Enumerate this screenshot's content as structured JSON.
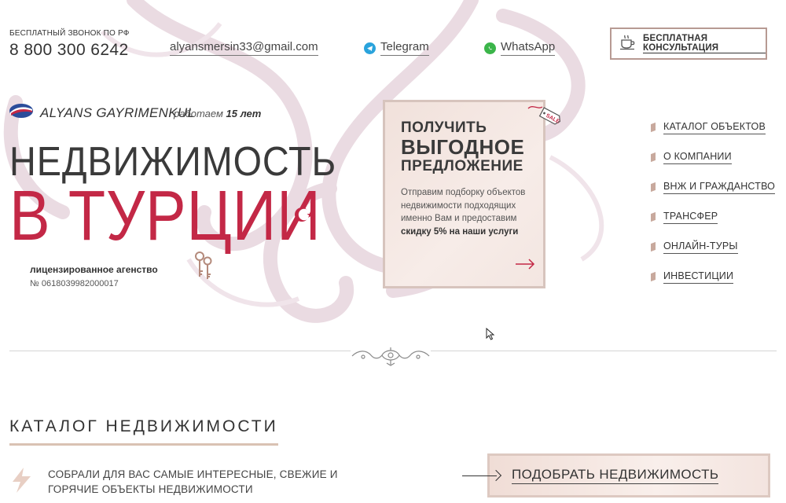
{
  "header": {
    "free_call_label": "БЕСПЛАТНЫЙ ЗВОНОК ПО РФ",
    "phone": "8 800 300 6242",
    "email": "alyansmersin33@gmail.com",
    "telegram_label": "Telegram",
    "whatsapp_label": "WhatsApp",
    "consult_label": "БЕСПЛАТНАЯ КОНСУЛЬТАЦИЯ"
  },
  "brand": {
    "name": "ALYANS GAYRIMENKUL",
    "years_prefix": "работаем",
    "years_value": "15 лет"
  },
  "hero": {
    "line1": "НЕДВИЖИМОСТЬ",
    "line2": "В ТУРЦИИ",
    "licensed": "лицензированное агенство",
    "license_no": "№ 0618039982000017"
  },
  "offer": {
    "line1": "получить",
    "line2": "ВЫГОДНОЕ",
    "line3": "ПРЕДЛОЖЕНИЕ",
    "desc": "Отправим подборку объектов недвижимости подходящих именно Вам и предоставим",
    "desc_bold": "скидку 5% на наши услуги",
    "tag_text": "SALE"
  },
  "nav": {
    "items": [
      {
        "label": "КАТАЛОГ ОБЪЕКТОВ"
      },
      {
        "label": "О КОМПАНИИ"
      },
      {
        "label": "ВНЖ И ГРАЖДАНСТВО"
      },
      {
        "label": "ТРАНСФЕР"
      },
      {
        "label": "ОНЛАЙН-ТУРЫ"
      },
      {
        "label": "ИНВЕСТИЦИИ"
      }
    ]
  },
  "catalog": {
    "title": "КАТАЛОГ НЕДВИЖИМОСТИ",
    "desc_line1": "СОБРАЛИ ДЛЯ ВАС САМЫЕ ИНТЕРЕСНЫЕ, СВЕЖИЕ И",
    "desc_line2": "ГОРЯЧИЕ ОБЪЕКТЫ НЕДВИЖИМОСТИ",
    "pick_label": "ПОДОБРАТЬ НЕДВИЖИМОСТЬ"
  },
  "colors": {
    "accent_red": "#c32846",
    "beige": "#d7c4bd",
    "telegram": "#2aa3dc",
    "whatsapp": "#3bb54a"
  }
}
